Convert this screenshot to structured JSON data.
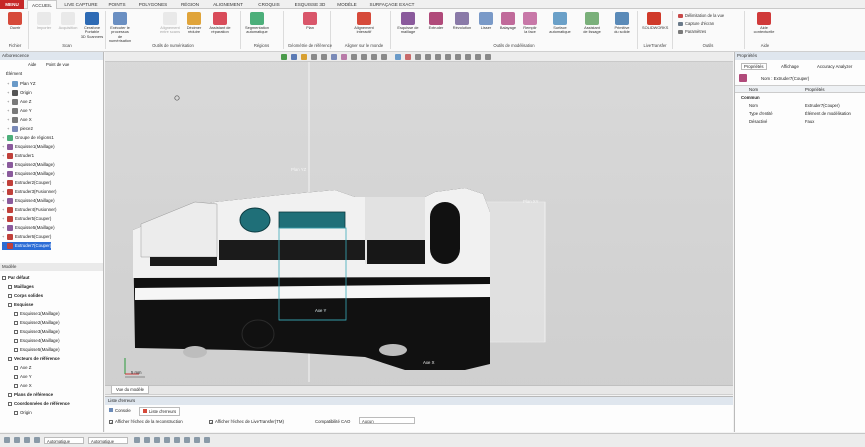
{
  "tabs": [
    "MENU",
    "ACCUEIL",
    "LIVE CAPTURE",
    "POINTS",
    "POLYGONES",
    "RÉGION",
    "ALIGNEMENT",
    "CROQUIS",
    "ESQUISSE 3D",
    "MODÈLE",
    "SURFAÇAGE EXACT"
  ],
  "ribbon": {
    "buttons": [
      {
        "label": "Ouvrir",
        "sub": "",
        "color": "#d64a3a"
      },
      {
        "label": "Importer",
        "sub": "",
        "color": "#c9c9c9"
      },
      {
        "label": "Acquisition",
        "sub": "",
        "color": "#c9c9c9"
      },
      {
        "label": "Cerafone Portable",
        "sub": "3D Scanners",
        "color": "#2e6bb5"
      },
      {
        "label": "Exécuter le processus",
        "sub": "de numérisation",
        "color": "#6a8fc2"
      },
      {
        "label": "Alignement",
        "sub": "entre scans",
        "color": "#c9c9c9"
      },
      {
        "label": "Décimer",
        "sub": "réduire",
        "color": "#e0a43a"
      },
      {
        "label": "Assistant de",
        "sub": "réparation",
        "color": "#d94c5a"
      },
      {
        "label": "Segmentation",
        "sub": "automatique",
        "color": "#4caf7a"
      },
      {
        "label": "Plan",
        "sub": "",
        "color": "#d9566a"
      },
      {
        "label": "Alignement",
        "sub": "interactif",
        "color": "#d64a3a"
      },
      {
        "label": "Esquisse de",
        "sub": "maillage",
        "color": "#8a5a9c"
      },
      {
        "label": "Extruder",
        "sub": "",
        "color": "#b04a7a"
      },
      {
        "label": "Révolution",
        "sub": "",
        "color": "#8a7aa8"
      },
      {
        "label": "Lisser",
        "sub": "",
        "color": "#7a9ac8"
      },
      {
        "label": "Balayage",
        "sub": "",
        "color": "#c06a9a"
      },
      {
        "label": "Remplir",
        "sub": "la face",
        "color": "#c878a8"
      },
      {
        "label": "Surface",
        "sub": "automatique",
        "color": "#6aa0c8"
      },
      {
        "label": "Assistant",
        "sub": "de lissage",
        "color": "#7ab07a"
      },
      {
        "label": "Primitive",
        "sub": "du solide",
        "color": "#5a8ab8"
      },
      {
        "label": "SOLIDWORKS",
        "sub": "",
        "color": "#d03a2a"
      },
      {
        "label": "Aide",
        "sub": "contextuelle",
        "color": "#d03a3a"
      }
    ],
    "side_tools": [
      "Délimitation de la vue",
      "Capture d'écran",
      "Paramètres"
    ],
    "groups": [
      "Fichier",
      "Scan",
      "Outils de numérisation",
      "Régions",
      "Géométrie de référence",
      "Aligner sur le monde",
      "Outils de modélisation",
      "LiveTransfer",
      "Outils",
      "Aide"
    ]
  },
  "left_panel": {
    "title": "Arborescence",
    "toolbar": [
      "Aide",
      "Point de vue"
    ],
    "element_label": "Élément",
    "features": [
      {
        "label": "Plan YZ",
        "indent": 1,
        "icon": "plane"
      },
      {
        "label": "Origin",
        "indent": 1,
        "icon": "origin"
      },
      {
        "label": "Axe Z",
        "indent": 1,
        "icon": "axis"
      },
      {
        "label": "Axe Y",
        "indent": 1,
        "icon": "axis"
      },
      {
        "label": "Axe X",
        "indent": 1,
        "icon": "axis"
      },
      {
        "label": "piece2",
        "indent": 1,
        "icon": "mesh"
      },
      {
        "label": "Groupe de régions1",
        "indent": 0,
        "icon": "region"
      },
      {
        "label": "Esquisse1(Maillage)",
        "indent": 0,
        "icon": "sketch"
      },
      {
        "label": "Extruder1",
        "indent": 0,
        "icon": "extrude"
      },
      {
        "label": "Esquisse2(Maillage)",
        "indent": 0,
        "icon": "sketch"
      },
      {
        "label": "Esquisse3(Maillage)",
        "indent": 0,
        "icon": "sketch"
      },
      {
        "label": "Extruder2(Couper)",
        "indent": 0,
        "icon": "extrude"
      },
      {
        "label": "Extruder3(Fusionner)",
        "indent": 0,
        "icon": "extrude"
      },
      {
        "label": "Esquisse4(Maillage)",
        "indent": 0,
        "icon": "sketch"
      },
      {
        "label": "Extruder4(Fusionner)",
        "indent": 0,
        "icon": "extrude"
      },
      {
        "label": "Extruder5(Couper)",
        "indent": 0,
        "icon": "extrude"
      },
      {
        "label": "Esquisse5(Maillage)",
        "indent": 0,
        "icon": "sketch"
      },
      {
        "label": "Extruder6(Couper)",
        "indent": 0,
        "icon": "extrude"
      },
      {
        "label": "Extruder7(Couper)",
        "indent": 0,
        "icon": "extrude",
        "selected": true
      }
    ],
    "model_title": "Modèle",
    "model": [
      {
        "label": "Par défaut",
        "indent": 0,
        "bold": true
      },
      {
        "label": "Maillages",
        "indent": 1,
        "bold": true
      },
      {
        "label": "Corps solides",
        "indent": 1,
        "bold": true
      },
      {
        "label": "Esquisse",
        "indent": 1,
        "bold": true
      },
      {
        "label": "Esquisse1(Maillage)",
        "indent": 2
      },
      {
        "label": "Esquisse2(Maillage)",
        "indent": 2
      },
      {
        "label": "Esquisse3(Maillage)",
        "indent": 2
      },
      {
        "label": "Esquisse4(Maillage)",
        "indent": 2
      },
      {
        "label": "Esquisse5(Maillage)",
        "indent": 2
      },
      {
        "label": "Vecteurs de référence",
        "indent": 1,
        "bold": true
      },
      {
        "label": "Axe Z",
        "indent": 2
      },
      {
        "label": "Axe Y",
        "indent": 2
      },
      {
        "label": "Axe X",
        "indent": 2
      },
      {
        "label": "Plans de référence",
        "indent": 1,
        "bold": true
      },
      {
        "label": "Coordonnées de référence",
        "indent": 1,
        "bold": true
      },
      {
        "label": "Origin",
        "indent": 2
      }
    ]
  },
  "viewport": {
    "labels": {
      "plane_yz": "Plan YZ",
      "plane_xy": "Plan XY",
      "axis_y": "Axe Y",
      "axis_x": "Axe X",
      "scale": "5 mm"
    },
    "tab": "Vue du modèle"
  },
  "error_panel": {
    "title": "Liste d'erreurs",
    "tabs": [
      "Console",
      "Liste d'erreurs"
    ],
    "options": [
      "Afficher l'échec de la reconstruction",
      "Afficher l'échec de LiveTransfer(TM)"
    ],
    "cad_label": "Compatibilité CAO",
    "cad_value": "Aucun"
  },
  "right_panel": {
    "title": "Propriétés",
    "tabs": [
      "Propriétés",
      "Affichage",
      "Accuracy Analyzer"
    ],
    "object_name": "Nom : Extruder7(Couper)",
    "columns": [
      "Nom",
      "Propriétés"
    ],
    "section": "Commun",
    "rows": [
      {
        "name": "Nom",
        "value": "Extruder7(Couper)"
      },
      {
        "name": "Type d'entité",
        "value": "Élément de modélisation"
      },
      {
        "name": "Désactivé",
        "value": "Faux"
      }
    ]
  },
  "status": {
    "mode1": "Automatique",
    "mode2": "Automatique"
  }
}
